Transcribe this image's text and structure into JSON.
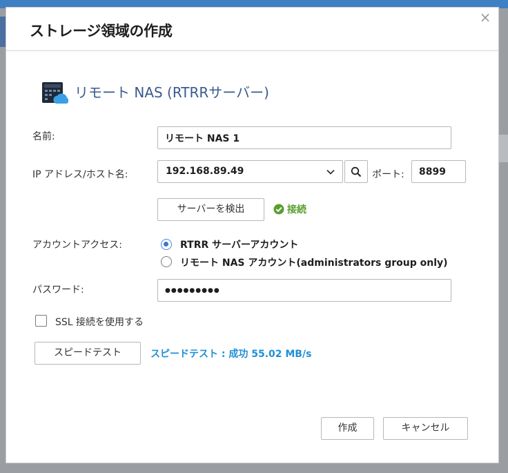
{
  "dialog": {
    "title": "ストレージ領域の作成",
    "close_symbol": "×",
    "heading": "リモート NAS (RTRRサーバー)",
    "icon": "nas-cloud-icon"
  },
  "form": {
    "name_label": "名前:",
    "name_value": "リモート NAS 1",
    "ip_label": "IP アドレス/ホスト名:",
    "ip_value": "192.168.89.49",
    "port_label": "ポート:",
    "port_value": "8899",
    "detect_button": "サーバーを検出",
    "connection_status": "接続",
    "account_label": "アカウントアクセス:",
    "account_options": [
      {
        "label": "RTRR サーバーアカウント",
        "selected": true
      },
      {
        "label": "リモート NAS アカウント(administrators group only)",
        "selected": false
      }
    ],
    "password_label": "パスワード:",
    "password_value": "●●●●●●●●●",
    "ssl_label": "SSL 接続を使用する",
    "ssl_checked": false,
    "speedtest_button": "スピードテスト",
    "speedtest_result": "スピードテスト : 成功 55.02 MB/s"
  },
  "footer": {
    "create_button": "作成",
    "cancel_button": "キャンセル"
  },
  "colors": {
    "heading": "#3a5a8c",
    "success": "#5a9e2f",
    "speed": "#1e8fd6",
    "radio_accent": "#3a78d4"
  }
}
